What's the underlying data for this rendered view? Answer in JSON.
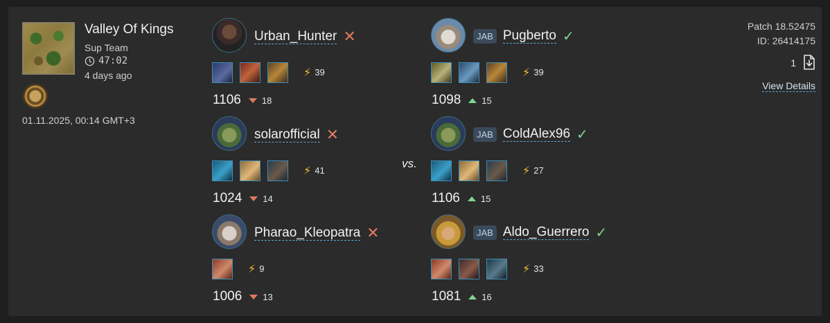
{
  "match": {
    "map_name": "Valley Of Kings",
    "mode": "Sup Team",
    "duration": "47:02",
    "ago": "4 days ago",
    "datetime": "01.11.2025, 00:14 GMT+3",
    "patch": "Patch 18.52475",
    "id": "ID: 26414175",
    "download_count": "1",
    "view_details": "View Details",
    "vs": "vs."
  },
  "colors": {
    "loss": "#e07a5f",
    "win": "#7fd68f",
    "bolt": "#f2c230",
    "card": "#2b2b2b"
  },
  "team_left": [
    {
      "name": "Urban_Hunter",
      "tag": "",
      "result": "loss",
      "apm": "39",
      "elo": "1106",
      "delta": "18",
      "avatar": "anubis-warrior-icon",
      "gods": [
        "anubis-god-icon",
        "red-warrior-god-icon",
        "pharaoh-god-icon"
      ]
    },
    {
      "name": "solarofficial",
      "tag": "",
      "result": "loss",
      "apm": "41",
      "elo": "1024",
      "delta": "14",
      "avatar": "nature-goddess-icon",
      "gods": [
        "poseidon-god-icon",
        "goddess-god-icon",
        "bearded-man-god-icon"
      ]
    },
    {
      "name": "Pharao_Kleopatra",
      "tag": "",
      "result": "loss",
      "apm": "9",
      "elo": "1006",
      "delta": "13",
      "avatar": "zeus-icon",
      "gods": [
        "huntress-god-icon"
      ]
    }
  ],
  "team_right": [
    {
      "name": "Pugberto",
      "tag": "JAB",
      "result": "win",
      "apm": "39",
      "elo": "1098",
      "delta": "15",
      "avatar": "old-sage-icon",
      "gods": [
        "eagle-god-icon",
        "blue-warrior-god-icon",
        "pharaoh-god-icon"
      ]
    },
    {
      "name": "ColdAlex96",
      "tag": "JAB",
      "result": "win",
      "apm": "27",
      "elo": "1106",
      "delta": "15",
      "avatar": "nature-goddess-icon",
      "gods": [
        "poseidon-god-icon",
        "goddess-god-icon",
        "bearded-man-god-icon"
      ]
    },
    {
      "name": "Aldo_Guerrero",
      "tag": "JAB",
      "result": "win",
      "apm": "33",
      "elo": "1081",
      "delta": "16",
      "avatar": "golden-queen-icon",
      "gods": [
        "huntress-god-icon",
        "minotaur-god-icon",
        "helmet-god-icon"
      ]
    }
  ]
}
